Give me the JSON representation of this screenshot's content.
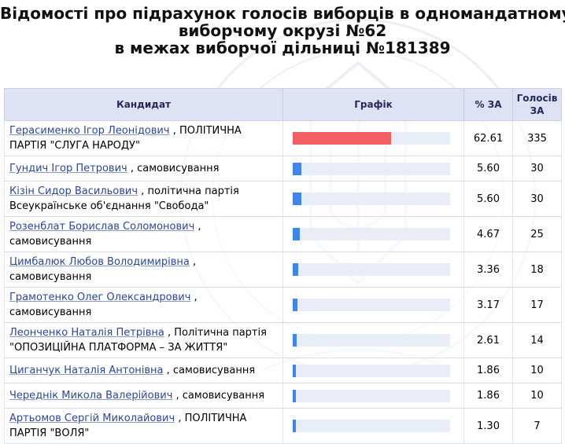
{
  "page": {
    "title_line1": "Відомості про підрахунок голосів виборців в одномандатному",
    "title_line2": "виборчому окрузі №62",
    "title_line3": "в межах виборчої дільниці №181389"
  },
  "table": {
    "headers": {
      "candidate": "Кандидат",
      "chart": "Графік",
      "percent": "% ЗА",
      "votes_line1": "Голосів",
      "votes_line2": "ЗА"
    },
    "colors": {
      "leader": "#f25e61",
      "other": "#3c86ee",
      "track": "#e8edf8"
    },
    "rows": [
      {
        "name": "Герасименко Ігор Леонідович",
        "desc": " , ПОЛІТИЧНА ПАРТІЯ \"СЛУГА НАРОДУ\"",
        "percent": "62.61",
        "votes": "335"
      },
      {
        "name": "Гундич Ігор Петрович",
        "desc": " , самовисування",
        "percent": "5.60",
        "votes": "30"
      },
      {
        "name": "Кізін Сидор Васильович",
        "desc": " , політична партія Всеукраїнське об'єднання \"Свобода\"",
        "percent": "5.60",
        "votes": "30"
      },
      {
        "name": "Розенблат Борислав Соломонович",
        "desc": " , самовисування",
        "percent": "4.67",
        "votes": "25"
      },
      {
        "name": "Цимбалюк Любов Володимирівна",
        "desc": " , самовисування",
        "percent": "3.36",
        "votes": "18"
      },
      {
        "name": "Грамотенко Олег Олександрович",
        "desc": " , самовисування",
        "percent": "3.17",
        "votes": "17"
      },
      {
        "name": "Леонченко Наталія Петрівна",
        "desc": " , Політична партія \"ОПОЗИЦІЙНА ПЛАТФОРМА – ЗА ЖИТТЯ\"",
        "percent": "2.61",
        "votes": "14"
      },
      {
        "name": "Циганчук Наталія Антонівна",
        "desc": " , самовисування",
        "percent": "1.86",
        "votes": "10"
      },
      {
        "name": "Череднік Микола Валерійович",
        "desc": " , самовисування",
        "percent": "1.86",
        "votes": "10"
      },
      {
        "name": "Артьомов Сергій Миколайович",
        "desc": " , ПОЛІТИЧНА ПАРТІЯ \"ВОЛЯ\"",
        "percent": "1.30",
        "votes": "7"
      }
    ]
  }
}
